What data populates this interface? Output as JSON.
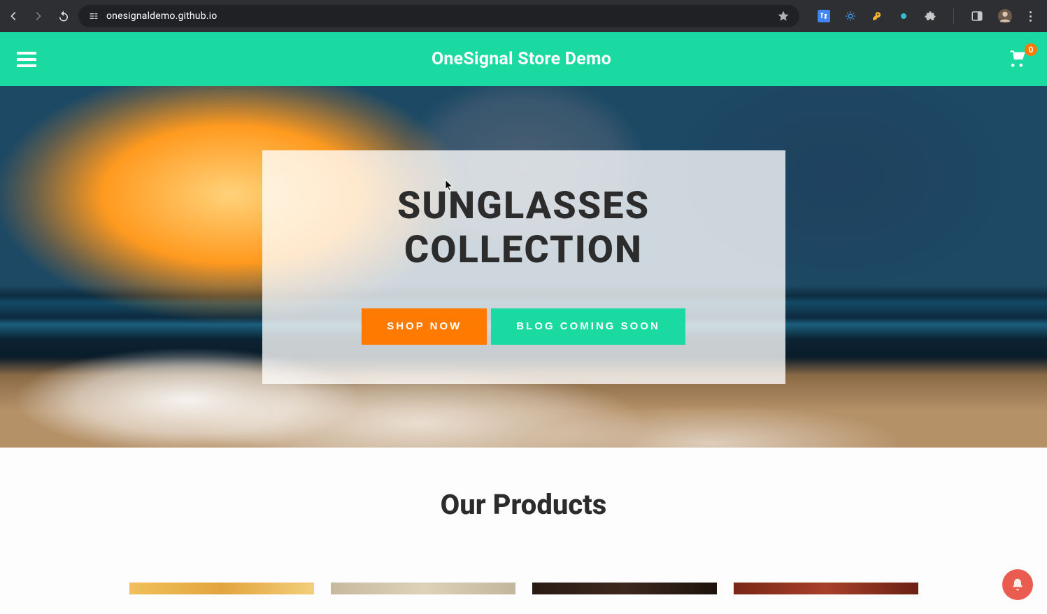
{
  "browser": {
    "url": "onesignaldemo.github.io"
  },
  "header": {
    "title": "OneSignal Store Demo",
    "cart_count": "0"
  },
  "hero": {
    "title": "SUNGLASSES COLLECTION",
    "cta_primary": "SHOP NOW",
    "cta_secondary": "BLOG COMING SOON"
  },
  "products": {
    "title": "Our Products"
  }
}
